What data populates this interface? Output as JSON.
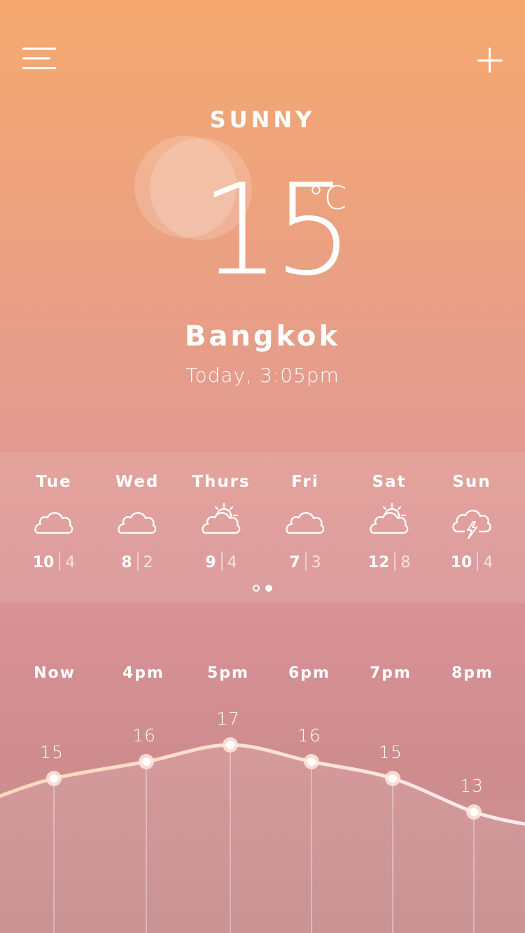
{
  "header": {
    "menu_icon": "hamburger-menu-icon",
    "add_icon": "plus-icon"
  },
  "current": {
    "condition": "SUNNY",
    "condition_icon": "sun-icon",
    "temperature": "15",
    "unit": "°C",
    "city": "Bangkok",
    "datetime": "Today, 3:05pm"
  },
  "forecast": [
    {
      "day": "Tue",
      "icon": "cloud-icon",
      "high": "10",
      "low": "4"
    },
    {
      "day": "Wed",
      "icon": "cloud-icon",
      "high": "8",
      "low": "2"
    },
    {
      "day": "Thurs",
      "icon": "partly-sunny-icon",
      "high": "9",
      "low": "4"
    },
    {
      "day": "Fri",
      "icon": "cloud-icon",
      "high": "7",
      "low": "3"
    },
    {
      "day": "Sat",
      "icon": "partly-sunny-icon",
      "high": "12",
      "low": "8"
    },
    {
      "day": "Sun",
      "icon": "thunderstorm-icon",
      "high": "10",
      "low": "4"
    }
  ],
  "pager": {
    "pages": 2,
    "active_page": 2
  },
  "hourly": [
    {
      "time": "Now",
      "temp": 15
    },
    {
      "time": "4pm",
      "temp": 16
    },
    {
      "time": "5pm",
      "temp": 17
    },
    {
      "time": "6pm",
      "temp": 16
    },
    {
      "time": "7pm",
      "temp": 15
    },
    {
      "time": "8pm",
      "temp": 13
    }
  ],
  "colors": {
    "gradient_top": "#f5a96f",
    "gradient_bottom": "#c99292",
    "curve_start": "#ffd9b8",
    "curve_end": "#ffeaf0"
  }
}
